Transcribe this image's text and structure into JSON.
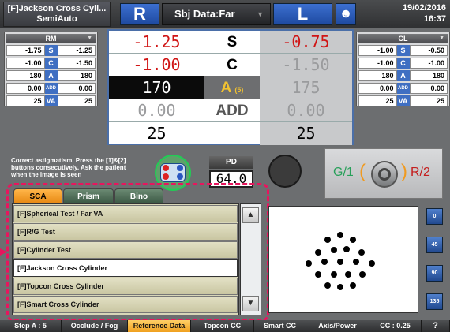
{
  "header": {
    "test_name": "[F]Jackson Cross Cyli...",
    "mode": "SemiAuto",
    "right_eye": "R",
    "left_eye": "L",
    "subject_data": "Sbj Data:Far",
    "date": "19/02/2016",
    "time": "16:37"
  },
  "rm_panel": {
    "title": "RM",
    "rows": [
      {
        "left": "-1.75",
        "label": "S",
        "right": "-1.25"
      },
      {
        "left": "-1.00",
        "label": "C",
        "right": "-1.50"
      },
      {
        "left": "180",
        "label": "A",
        "right": "180"
      },
      {
        "left": "0.00",
        "label": "ADD",
        "right": "0.00"
      },
      {
        "left": "25",
        "label": "VA",
        "right": "25"
      }
    ]
  },
  "cl_panel": {
    "title": "CL",
    "rows": [
      {
        "left": "-1.00",
        "label": "S",
        "right": "-0.50"
      },
      {
        "left": "-1.00",
        "label": "C",
        "right": "-1.00"
      },
      {
        "left": "180",
        "label": "A",
        "right": "180"
      },
      {
        "left": "0.00",
        "label": "ADD",
        "right": "0.00"
      },
      {
        "left": "25",
        "label": "VA",
        "right": "25"
      }
    ]
  },
  "main_grid": {
    "rows": [
      {
        "right": "-1.25",
        "label": "S",
        "left": "-0.75"
      },
      {
        "right": "-1.00",
        "label": "C",
        "left": "-1.50"
      },
      {
        "right": "170",
        "label": "A",
        "step": "(5)",
        "left": "175"
      },
      {
        "right": "0.00",
        "label": "ADD",
        "left": "0.00"
      },
      {
        "right": "25",
        "label": "",
        "left": "25"
      }
    ]
  },
  "instruction": "Correct astigmatism. Press the [1]&[2] buttons consecutively. Ask the patient when the image is seen",
  "pd": {
    "label": "PD",
    "value": "64.0"
  },
  "cross_cyl": {
    "left_label": "G/1",
    "right_label": "R/2"
  },
  "tabs": [
    {
      "label": "SCA"
    },
    {
      "label": "Prism"
    },
    {
      "label": "Bino"
    }
  ],
  "test_list": [
    "[F]Spherical Test / Far VA",
    "[F]R/G Test",
    "[F]Cylinder Test",
    "[F]Jackson Cross Cylinder",
    "[F]Topcon Cross Cylinder",
    "[F]Smart Cross Cylinder"
  ],
  "axis_buttons": [
    "0",
    "45",
    "90",
    "135"
  ],
  "bottom_bar": [
    "Step A : 5",
    "Occlude / Fog",
    "Reference Data",
    "Topcon CC",
    "Smart CC",
    "Axis/Power",
    "CC : 0.25",
    "?"
  ],
  "colors": {
    "accent": "#2f63c0",
    "highlight": "#e8155e",
    "tab_active": "#f0a020"
  }
}
